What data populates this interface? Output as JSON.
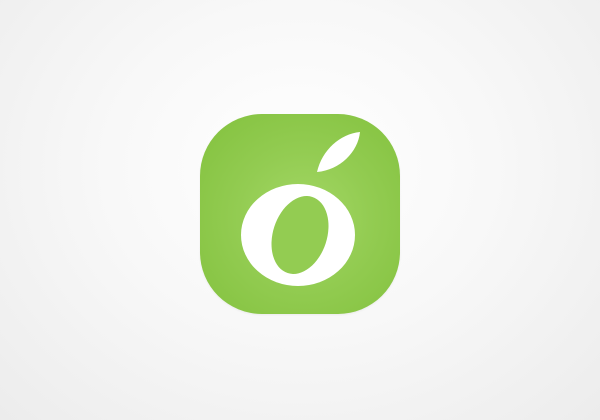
{
  "app_icon": {
    "name": "olive app icon",
    "icon": "olive-logo-icon",
    "glyph": "o",
    "colors": {
      "background": "#ffffff",
      "tile_light": "#a4d866",
      "tile_dark": "#82c13d",
      "glyph": "#ffffff"
    }
  }
}
